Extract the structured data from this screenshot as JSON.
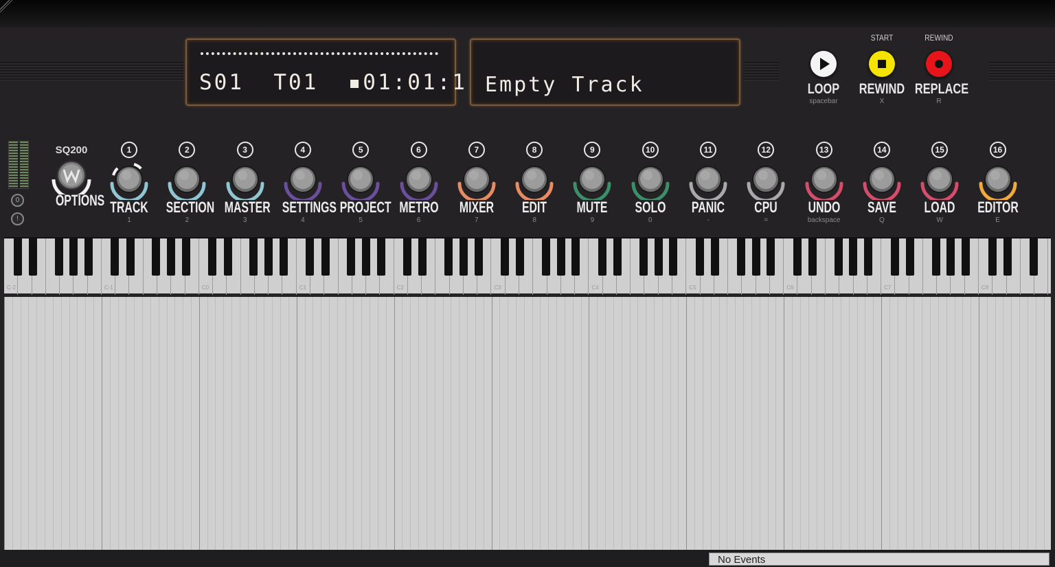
{
  "display": {
    "position": "S01  T01  ▪01:01:1",
    "track_name": "Empty Track"
  },
  "transport": [
    {
      "top": "",
      "label": "LOOP",
      "key": "spacebar",
      "icon": "play-icon",
      "color": "#f4f4f4"
    },
    {
      "top": "START",
      "label": "REWIND",
      "key": "X",
      "icon": "stop-icon",
      "color": "#f5e400"
    },
    {
      "top": "REWIND",
      "label": "REPLACE",
      "key": "R",
      "icon": "record-icon",
      "color": "#e8141c"
    }
  ],
  "brand": "SQ200",
  "options_label": "OPTIONS",
  "meter_buttons": [
    "0",
    "!"
  ],
  "knobs": [
    {
      "num": "1",
      "label": "TRACK",
      "key": "1",
      "color": "#8fc6d2"
    },
    {
      "num": "2",
      "label": "SECTION",
      "key": "2",
      "color": "#8fc6d2"
    },
    {
      "num": "3",
      "label": "MASTER",
      "key": "3",
      "color": "#8fc6d2"
    },
    {
      "num": "4",
      "label": "SETTINGS",
      "key": "4",
      "color": "#6a4f9c"
    },
    {
      "num": "5",
      "label": "PROJECT",
      "key": "5",
      "color": "#6a4f9c"
    },
    {
      "num": "6",
      "label": "METRO",
      "key": "6",
      "color": "#6a4f9c"
    },
    {
      "num": "7",
      "label": "MIXER",
      "key": "7",
      "color": "#e78b63"
    },
    {
      "num": "8",
      "label": "EDIT",
      "key": "8",
      "color": "#e78b63"
    },
    {
      "num": "9",
      "label": "MUTE",
      "key": "9",
      "color": "#3b8f6a"
    },
    {
      "num": "10",
      "label": "SOLO",
      "key": "0",
      "color": "#3b8f6a"
    },
    {
      "num": "11",
      "label": "PANIC",
      "key": "-",
      "color": "#a9a9a9"
    },
    {
      "num": "12",
      "label": "CPU",
      "key": "=",
      "color": "#a9a9a9"
    },
    {
      "num": "13",
      "label": "UNDO",
      "key": "backspace",
      "color": "#d44d6a"
    },
    {
      "num": "14",
      "label": "SAVE",
      "key": "Q",
      "color": "#d44d6a"
    },
    {
      "num": "15",
      "label": "LOAD",
      "key": "W",
      "color": "#d44d6a"
    },
    {
      "num": "16",
      "label": "EDITOR",
      "key": "E",
      "color": "#f2a93b"
    }
  ],
  "octaves": [
    "C-2",
    "C-1",
    "C0",
    "C1",
    "C2",
    "C3",
    "C4",
    "C5",
    "C6",
    "C7",
    "C8"
  ],
  "status": "No Events"
}
